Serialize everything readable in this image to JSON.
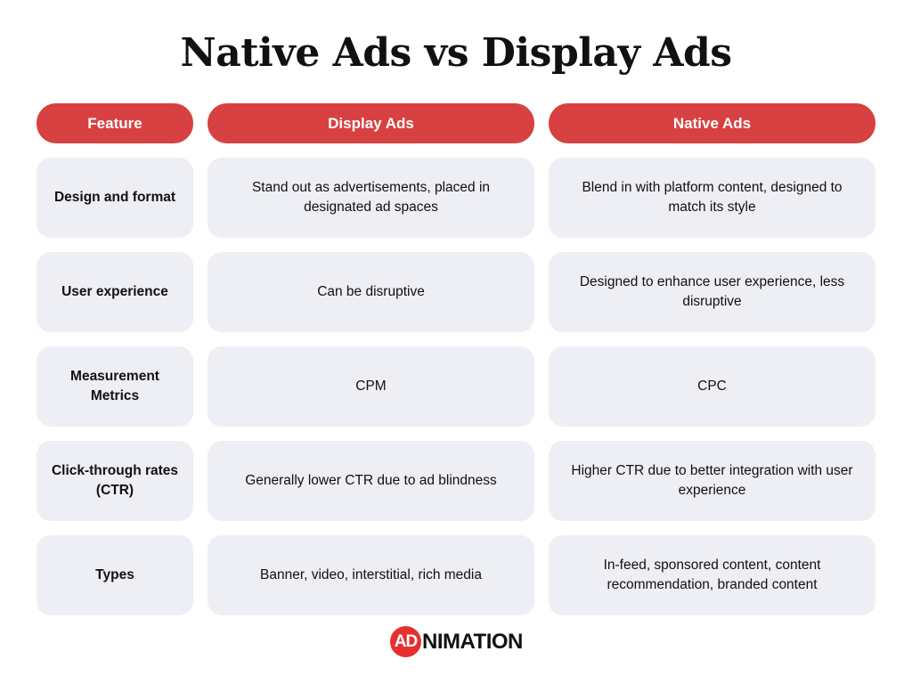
{
  "title": "Native Ads vs Display Ads",
  "headers": [
    "Feature",
    "Display Ads",
    "Native Ads"
  ],
  "rows": [
    {
      "feature": "Design and format",
      "display": "Stand out as advertisements, placed in designated ad spaces",
      "native": "Blend in with platform content, designed to match its style"
    },
    {
      "feature": "User experience",
      "display": "Can be disruptive",
      "native": "Designed to enhance user experience, less disruptive"
    },
    {
      "feature": "Measurement Metrics",
      "display": "CPM",
      "native": "CPC"
    },
    {
      "feature": "Click-through rates (CTR)",
      "display": "Generally lower CTR due to ad blindness",
      "native": "Higher CTR due to better integration with user experience"
    },
    {
      "feature": "Types",
      "display": "Banner, video, interstitial, rich media",
      "native": "In-feed, sponsored content, content recommendation, branded content"
    }
  ],
  "logo": {
    "badge": "AD",
    "rest": "NIMATION"
  },
  "colors": {
    "accent": "#d84141",
    "cell_bg": "#eeeef5"
  }
}
